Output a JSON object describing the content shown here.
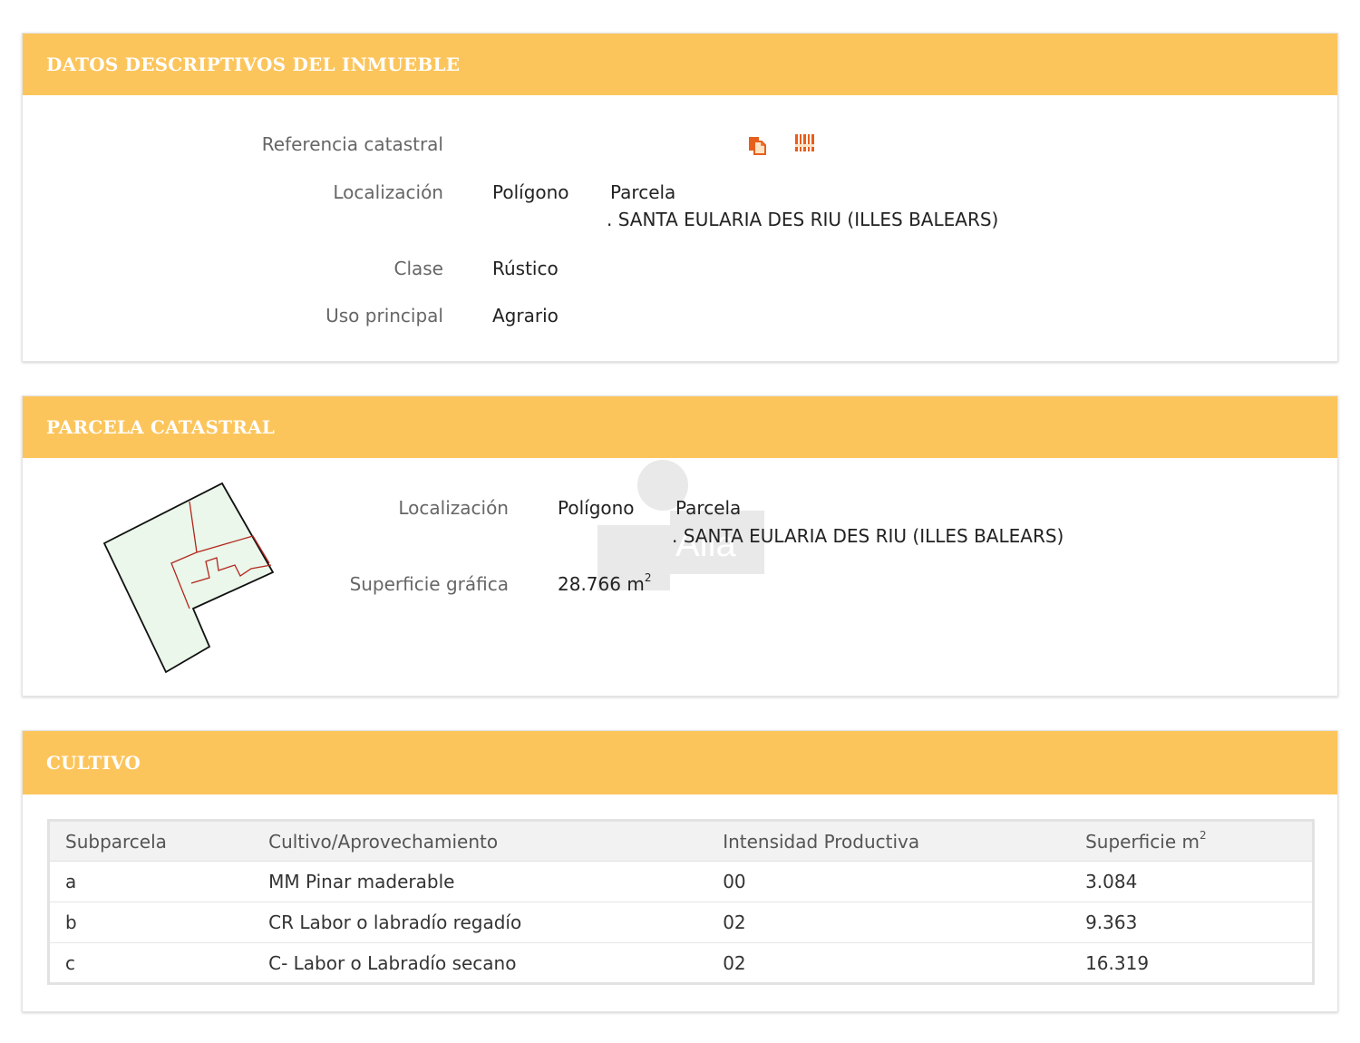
{
  "datos": {
    "title": "DATOS DESCRIPTIVOS DEL INMUEBLE",
    "ref_label": "Referencia catastral",
    "ref_icons": [
      "copy-icon",
      "barcode-icon"
    ],
    "loc_label": "Localización",
    "poligono": "Polígono",
    "parcela": "Parcela",
    "municipio": ". SANTA EULARIA DES RIU (ILLES BALEARS)",
    "clase_label": "Clase",
    "clase_value": "Rústico",
    "uso_label": "Uso principal",
    "uso_value": "Agrario"
  },
  "parcela": {
    "title": "PARCELA CATASTRAL",
    "loc_label": "Localización",
    "poligono": "Polígono",
    "parcela": "Parcela",
    "municipio": ". SANTA EULARIA DES RIU (ILLES BALEARS)",
    "superficie_label": "Superficie gráfica",
    "superficie_value": "28.766 m",
    "superficie_unit_sup": "2",
    "watermark_text": "Alla"
  },
  "cultivo": {
    "title": "CULTIVO",
    "headers": [
      "Subparcela",
      "Cultivo/Aprovechamiento",
      "Intensidad Productiva",
      "Superficie m"
    ],
    "header_sup": "2",
    "rows": [
      [
        "a",
        "MM Pinar maderable",
        "00",
        "3.084"
      ],
      [
        "b",
        "CR Labor o labradío regadío",
        "02",
        "9.363"
      ],
      [
        "c",
        "C- Labor o Labradío secano",
        "02",
        "16.319"
      ]
    ]
  },
  "colors": {
    "header_bg": "#fcc55c",
    "plot_fill": "#eaf7ea",
    "plot_inner_line": "#b3261e",
    "icon_orange": "#e85f1c"
  }
}
